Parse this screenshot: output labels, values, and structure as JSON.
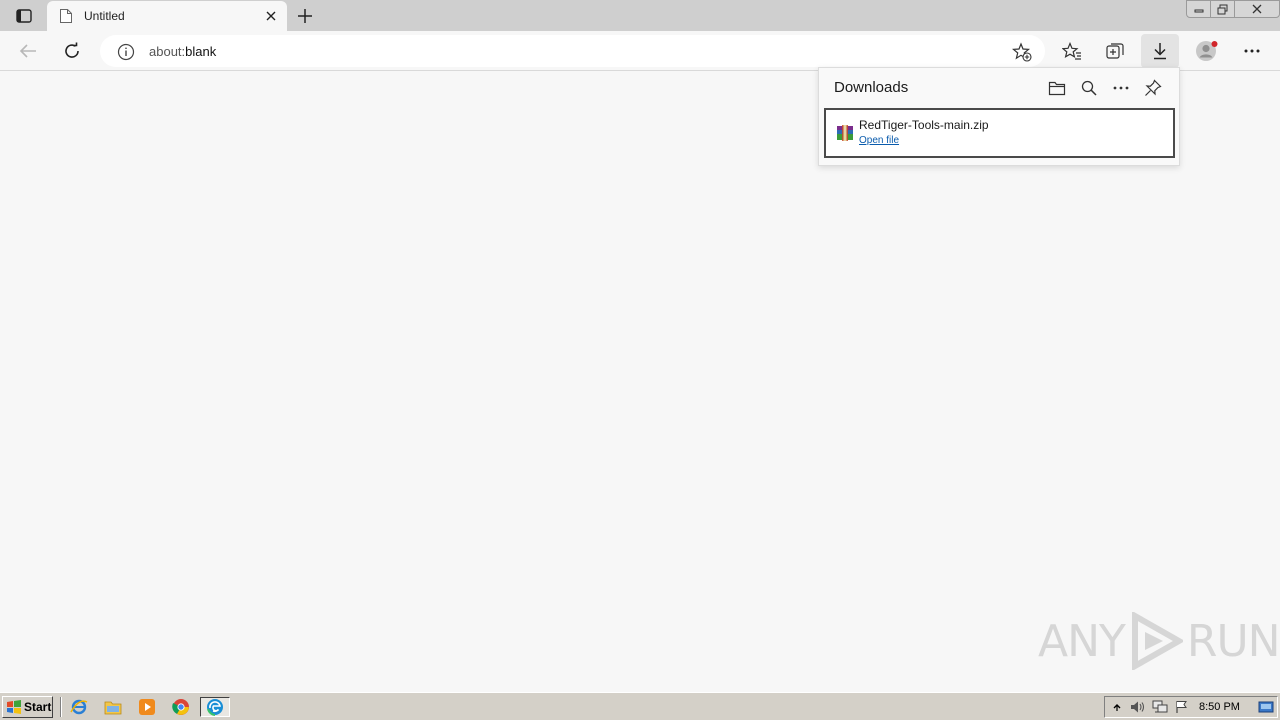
{
  "tab": {
    "title": "Untitled"
  },
  "address_bar": {
    "scheme": "about:",
    "host": "blank"
  },
  "downloads": {
    "title": "Downloads",
    "items": [
      {
        "filename": "RedTiger-Tools-main.zip",
        "action": "Open file"
      }
    ]
  },
  "watermark": {
    "left": "ANY",
    "right": "RUN"
  },
  "taskbar": {
    "start_label": "Start",
    "clock": "8:50 PM"
  },
  "icons": {
    "tab_actions": "tab-actions-icon",
    "page": "page-icon",
    "close": "close-icon",
    "new_tab": "plus-icon",
    "back": "back-arrow-icon",
    "refresh": "refresh-icon",
    "info": "info-icon",
    "add_favorite": "star-plus-icon",
    "favorites": "favorites-icon",
    "collections": "collections-icon",
    "downloads": "download-icon",
    "profile": "profile-icon",
    "more": "more-icon",
    "open_folder": "folder-icon",
    "search": "search-icon",
    "pin": "pin-icon",
    "archive": "archive-icon"
  },
  "colors": {
    "tabstrip": "#cfcfcf",
    "page_bg": "#f7f7f7",
    "link": "#0b5cad",
    "taskbar": "#d4d0c8"
  }
}
